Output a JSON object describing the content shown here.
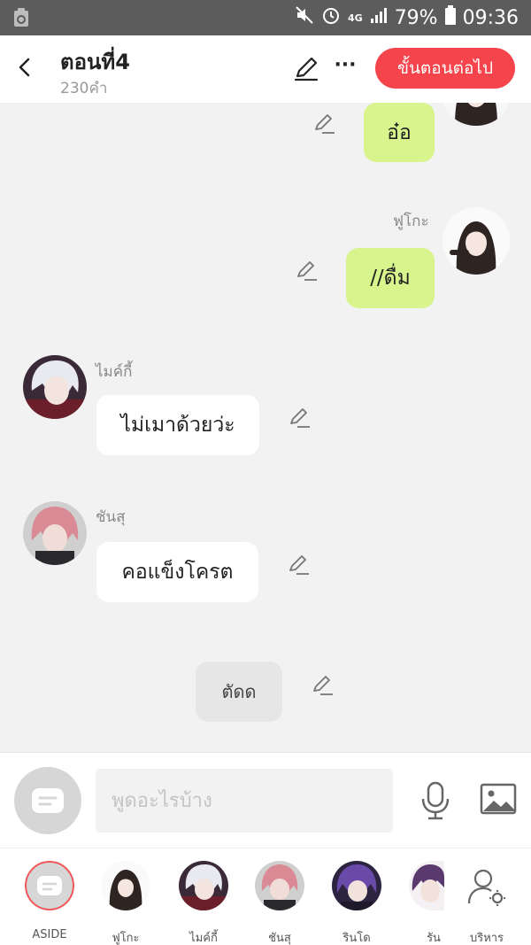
{
  "status_bar": {
    "network": "4G",
    "battery": "79%",
    "time": "09:36"
  },
  "header": {
    "title": "ตอนที่4",
    "subtitle": "230คำ",
    "next_label": "ขั้นตอนต่อไป"
  },
  "messages": [
    {
      "speaker": "",
      "text": "อ๋อ",
      "side": "right"
    },
    {
      "speaker": "ฟูโกะ",
      "text": "//ดื่ม",
      "side": "right"
    },
    {
      "speaker": "ไมค์กี้",
      "text": "ไม่เมาด้วยว่ะ",
      "side": "left"
    },
    {
      "speaker": "ชันสุ",
      "text": "คอแข็งโครต",
      "side": "left"
    },
    {
      "speaker": "",
      "text": "ตัดด",
      "side": "center"
    }
  ],
  "input": {
    "placeholder": "พูดอะไรบ้าง"
  },
  "characters": [
    {
      "label": "ASIDE"
    },
    {
      "label": "ฟูโกะ"
    },
    {
      "label": "ไมค์กี้"
    },
    {
      "label": "ชันสุ"
    },
    {
      "label": "รินโด"
    },
    {
      "label": "รัน"
    },
    {
      "label": "บริหาร"
    }
  ],
  "colors": {
    "accent": "#f5444c",
    "bubble_green": "#d7f58c",
    "status_bar": "#5c5c5c"
  }
}
